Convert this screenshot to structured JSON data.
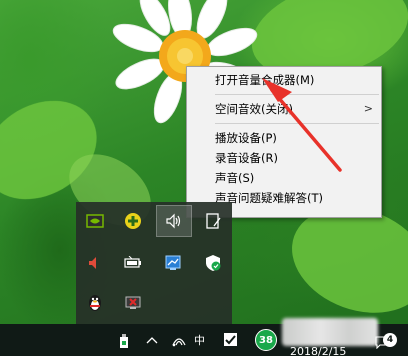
{
  "context_menu": {
    "items": [
      {
        "label": "打开音量合成器(M)",
        "has_submenu": false
      },
      {
        "label": "空间音效(关闭)",
        "has_submenu": true
      },
      {
        "label": "播放设备(P)",
        "has_submenu": false
      },
      {
        "label": "录音设备(R)",
        "has_submenu": false
      },
      {
        "label": "声音(S)",
        "has_submenu": false
      },
      {
        "label": "声音问题疑难解答(T)",
        "has_submenu": false
      }
    ],
    "submenu_arrow": ">"
  },
  "tray_flyout": {
    "icons": [
      "nvidia-icon",
      "plus-badge-icon",
      "speaker-icon",
      "tablet-pen-icon",
      "speaker-muted-icon",
      "battery-icon",
      "network-monitor-icon",
      "windows-defender-icon",
      "qq-penguin-icon",
      "network-error-icon"
    ]
  },
  "taskbar": {
    "ime_label": "中",
    "badge_value": "38",
    "date": "2018/2/15",
    "notification_count": "4"
  },
  "colors": {
    "menu_bg": "#f2f2f2",
    "annotation_arrow": "#e8322a",
    "taskbar_bg": "#101a16",
    "badge_green": "#1aa84a"
  }
}
